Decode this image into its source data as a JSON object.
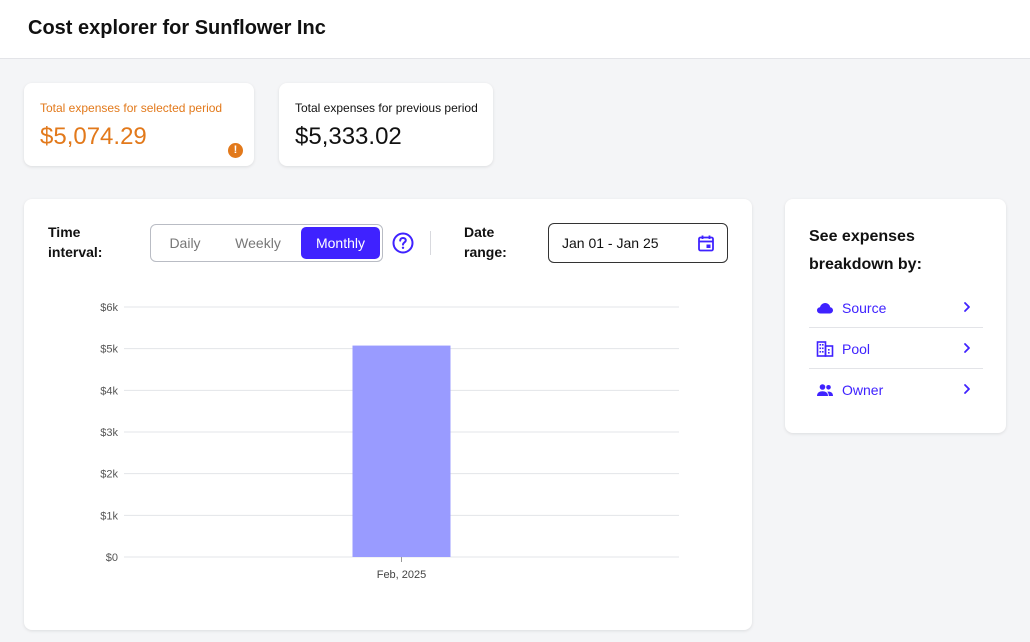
{
  "header": {
    "title": "Cost explorer for Sunflower Inc"
  },
  "summary": {
    "selected": {
      "label": "Total expenses for selected period",
      "value": "$5,074.29"
    },
    "previous": {
      "label": "Total expenses for previous period",
      "value": "$5,333.02"
    }
  },
  "controls": {
    "time_interval_label_line1": "Time",
    "time_interval_label_line2": "interval:",
    "intervals": [
      "Daily",
      "Weekly",
      "Monthly"
    ],
    "selected_interval": "Monthly",
    "date_range_label_line1": "Date",
    "date_range_label_line2": "range:",
    "date_range_value": "Jan 01 - Jan 25"
  },
  "colors": {
    "accent": "#3f22ff",
    "warning": "#e2791b",
    "bar": "#999bff"
  },
  "icons": {
    "warning": "exclamation-circle-icon",
    "help": "help-circle-icon",
    "calendar": "calendar-icon",
    "source": "cloud-icon",
    "pool": "building-icon",
    "owner": "people-icon",
    "chevron": "chevron-right-icon"
  },
  "chart_data": {
    "type": "bar",
    "categories": [
      "Feb, 2025"
    ],
    "values": [
      5074.29
    ],
    "ylim": [
      0,
      6000
    ],
    "yticks": [
      {
        "value": 0,
        "label": "$0"
      },
      {
        "value": 1000,
        "label": "$1k"
      },
      {
        "value": 2000,
        "label": "$2k"
      },
      {
        "value": 3000,
        "label": "$3k"
      },
      {
        "value": 4000,
        "label": "$4k"
      },
      {
        "value": 5000,
        "label": "$5k"
      },
      {
        "value": 6000,
        "label": "$6k"
      }
    ],
    "grid": true,
    "title": "",
    "xlabel": "",
    "ylabel": ""
  },
  "breakdown": {
    "title": "See expenses breakdown by:",
    "items": [
      {
        "label": "Source"
      },
      {
        "label": "Pool"
      },
      {
        "label": "Owner"
      }
    ]
  }
}
